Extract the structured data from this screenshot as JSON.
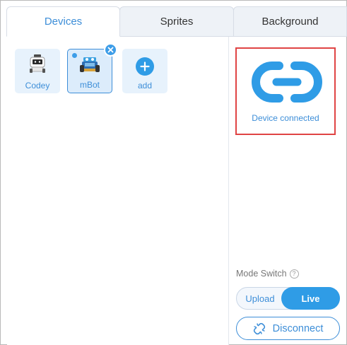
{
  "tabs": [
    {
      "label": "Devices",
      "active": true
    },
    {
      "label": "Sprites",
      "active": false
    },
    {
      "label": "Background",
      "active": false
    }
  ],
  "devices": [
    {
      "label": "Codey",
      "icon": "codey-robot-icon"
    },
    {
      "label": "mBot",
      "icon": "mbot-robot-icon",
      "selected": true
    },
    {
      "label": "add",
      "icon": "plus-icon"
    }
  ],
  "connection": {
    "status_text": "Device connected",
    "icon": "link-icon"
  },
  "mode_switch": {
    "label": "Mode Switch",
    "options": [
      "Upload",
      "Live"
    ],
    "selected": "Live"
  },
  "disconnect_label": "Disconnect",
  "colors": {
    "accent": "#3d8ed8",
    "accent_bright": "#2f9ce6",
    "highlight_border": "#e04444",
    "card_bg": "#e7f2fc"
  }
}
